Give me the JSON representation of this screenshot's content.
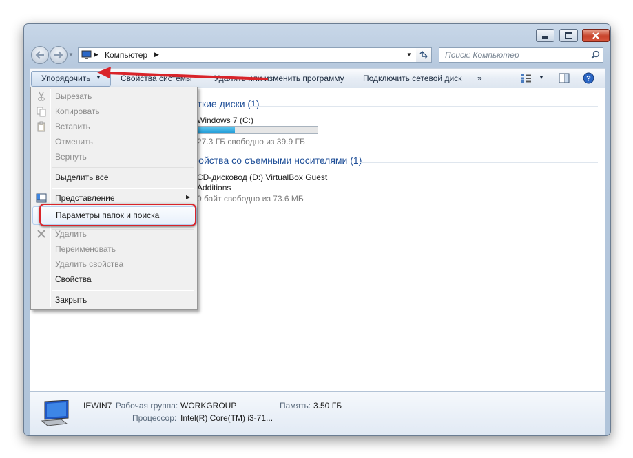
{
  "window": {
    "address_segments": [
      "Компьютер"
    ],
    "search_placeholder": "Поиск: Компьютер"
  },
  "toolbar": {
    "organize_label": "Упорядочить",
    "system_properties_label": "Свойства системы",
    "uninstall_label": "Удалить или изменить программу",
    "map_drive_label": "Подключить сетевой диск",
    "more_label": "»"
  },
  "content": {
    "hdd_group_header": "Жесткие диски (1)",
    "drive_c_name": "Windows 7 (C:)",
    "drive_c_free_text": "27.3 ГБ свободно из 39.9 ГБ",
    "drive_c_used_fraction": 0.31,
    "removable_group_header": "Устройства со съемными носителями (1)",
    "drive_d_name_line1": "CD-дисковод (D:) VirtualBox Guest",
    "drive_d_name_line2": "Additions",
    "drive_d_free_text": "0 байт свободно из 73.6 МБ"
  },
  "details": {
    "computer_name": "IEWIN7",
    "workgroup_label": "Рабочая группа:",
    "workgroup_value": "WORKGROUP",
    "memory_label": "Память:",
    "memory_value": "3.50 ГБ",
    "processor_label": "Процессор:",
    "processor_value": "Intel(R) Core(TM) i3-71..."
  },
  "menu": {
    "cut": "Вырезать",
    "copy": "Копировать",
    "paste": "Вставить",
    "undo": "Отменить",
    "redo": "Вернуть",
    "select_all": "Выделить все",
    "layout": "Представление",
    "folder_options": "Параметры папок и поиска",
    "delete": "Удалить",
    "rename": "Переименовать",
    "remove_properties": "Удалить свойства",
    "properties": "Свойства",
    "close": "Закрыть"
  },
  "colors": {
    "annotation_red": "#d9242a",
    "progress_fill": "#26a0da",
    "group_header": "#1f4f98"
  },
  "icons": [
    "back-arrow-icon",
    "forward-arrow-icon",
    "computer-icon",
    "refresh-icon",
    "search-icon",
    "view-options-icon",
    "preview-pane-icon",
    "help-icon",
    "scissors-icon",
    "copy-icon",
    "paste-icon",
    "layout-icon",
    "delete-x-icon",
    "workstation-icon"
  ]
}
